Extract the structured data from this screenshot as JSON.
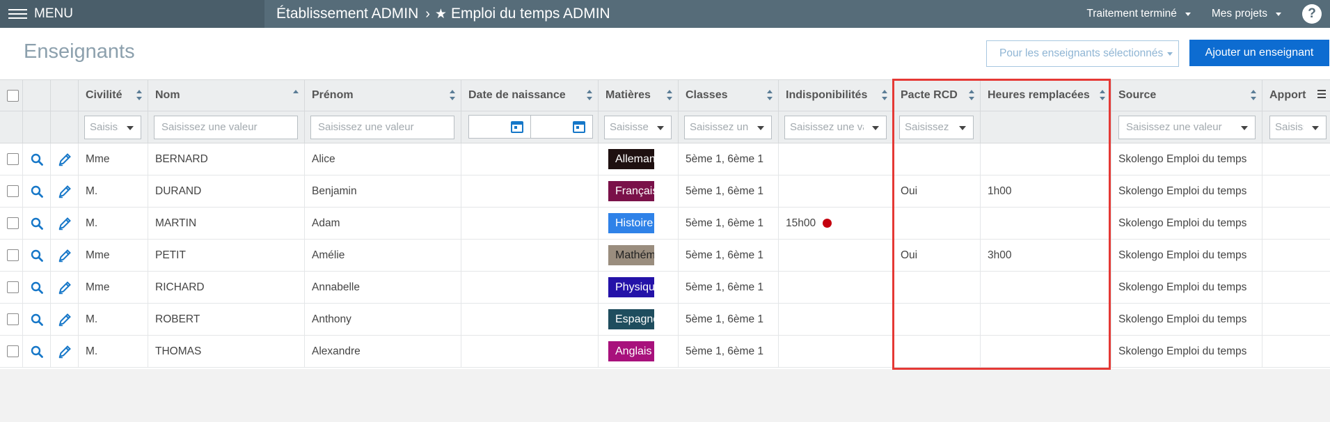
{
  "topbar": {
    "menu_label": "MENU",
    "breadcrumb_school": "Établissement ADMIN",
    "breadcrumb_separator": "›",
    "breadcrumb_timetable": "Emploi du temps ADMIN",
    "status_label": "Traitement terminé",
    "projects_label": "Mes projets",
    "help_label": "?"
  },
  "page": {
    "title": "Enseignants",
    "bulk_action_placeholder": "Pour les enseignants sélectionnés",
    "add_button": "Ajouter un enseignant"
  },
  "columns": {
    "civilite": "Civilité",
    "nom": "Nom",
    "prenom": "Prénom",
    "date_naissance": "Date de naissance",
    "matieres": "Matières",
    "classes": "Classes",
    "indisponibilites": "Indisponibilités",
    "pacte_rcd": "Pacte RCD",
    "heures_remplacees": "Heures remplacées",
    "source": "Source",
    "apport": "Apport"
  },
  "filters": {
    "civilite": "Saisissez",
    "nom": "Saisissez une valeur",
    "prenom": "Saisissez une valeur",
    "matieres": "Saisissez",
    "classes": "Saisissez une",
    "indisponibilites": "Saisissez une va",
    "pacte_rcd": "Saisissez",
    "source": "Saisissez une valeur",
    "apport": "Saisissez"
  },
  "rows": [
    {
      "civilite": "Mme",
      "nom": "BERNARD",
      "prenom": "Alice",
      "matiere": "Allemand",
      "matiere_color": "#1e1010",
      "classes": "5ème 1, 6ème 1",
      "indispo": "",
      "indispo_dot": false,
      "pacte": "",
      "heures": "",
      "source": "Skolengo Emploi du temps"
    },
    {
      "civilite": "M.",
      "nom": "DURAND",
      "prenom": "Benjamin",
      "matiere": "Français",
      "matiere_color": "#7a1149",
      "classes": "5ème 1, 6ème 1",
      "indispo": "",
      "indispo_dot": false,
      "pacte": "Oui",
      "heures": "1h00",
      "source": "Skolengo Emploi du temps"
    },
    {
      "civilite": "M.",
      "nom": "MARTIN",
      "prenom": "Adam",
      "matiere": "Histoire",
      "matiere_color": "#2f82e8",
      "classes": "5ème 1, 6ème 1",
      "indispo": "15h00",
      "indispo_dot": true,
      "pacte": "",
      "heures": "",
      "source": "Skolengo Emploi du temps"
    },
    {
      "civilite": "Mme",
      "nom": "PETIT",
      "prenom": "Amélie",
      "matiere": "Mathématiques",
      "matiere_color": "#9a8d7e",
      "matiere_text_color": "#222",
      "classes": "5ème 1, 6ème 1",
      "indispo": "",
      "indispo_dot": false,
      "pacte": "Oui",
      "heures": "3h00",
      "source": "Skolengo Emploi du temps"
    },
    {
      "civilite": "Mme",
      "nom": "RICHARD",
      "prenom": "Annabelle",
      "matiere": "Physique",
      "matiere_color": "#2412a8",
      "classes": "5ème 1, 6ème 1",
      "indispo": "",
      "indispo_dot": false,
      "pacte": "",
      "heures": "",
      "source": "Skolengo Emploi du temps"
    },
    {
      "civilite": "M.",
      "nom": "ROBERT",
      "prenom": "Anthony",
      "matiere": "Espagnol",
      "matiere_color": "#1f4d5e",
      "classes": "5ème 1, 6ème 1",
      "indispo": "",
      "indispo_dot": false,
      "pacte": "",
      "heures": "",
      "source": "Skolengo Emploi du temps"
    },
    {
      "civilite": "M.",
      "nom": "THOMAS",
      "prenom": "Alexandre",
      "matiere": "Anglais",
      "matiere_color": "#a8117c",
      "classes": "5ème 1, 6ème 1",
      "indispo": "",
      "indispo_dot": false,
      "pacte": "",
      "heures": "",
      "source": "Skolengo Emploi du temps"
    }
  ]
}
